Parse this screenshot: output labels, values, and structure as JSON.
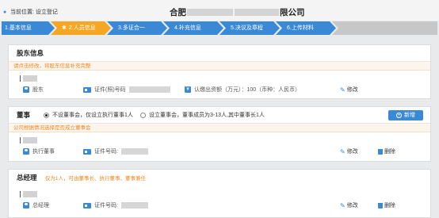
{
  "header": {
    "location_label": "当前位置: 设立登记",
    "company_prefix": "合肥",
    "company_suffix": "限公司"
  },
  "steps": [
    {
      "label": "1.基本信息"
    },
    {
      "label": "2.人员信息"
    },
    {
      "label": "3.多证合一"
    },
    {
      "label": "4.补充信息"
    },
    {
      "label": "5.决议及章程"
    },
    {
      "label": "6.上传材料"
    }
  ],
  "colors": {
    "accent": "#3a89d6",
    "active_step": "#f5a623",
    "warning": "#f08a24"
  },
  "shareholder": {
    "title": "股东信息",
    "warning": "请点击修改，将股东信息补充完整",
    "role": "股东",
    "id_label": "证件(照)号码",
    "capital": "认缴出资额（万元）：100（币种：人民币）",
    "edit_label": "修改"
  },
  "board": {
    "title": "董事",
    "option_1": "不设董事会，仅设立执行董事1人",
    "option_2": "设立董事会，董事成员为3-13人,其中董事长1人",
    "add_label": "新增",
    "warning": "公司根据情况选择是否成立董事会",
    "role": "执行董事",
    "id_label": "证件号码:",
    "edit_label": "修改",
    "delete_label": "删除"
  },
  "manager": {
    "title": "总经理",
    "note": "仅为1人，可由董事长、执行董事、董事兼任",
    "role": "总经理",
    "id_label": "证件号码:",
    "edit_label": "修改",
    "delete_label": "删除"
  }
}
